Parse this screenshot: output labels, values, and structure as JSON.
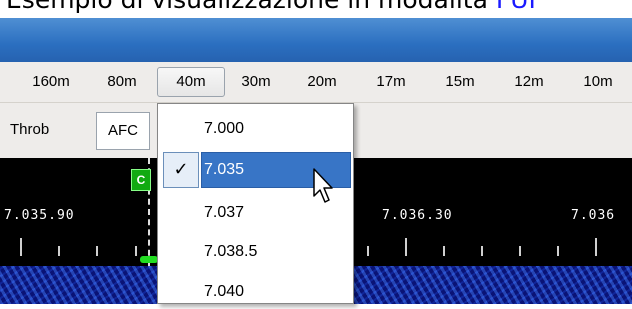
{
  "caption": {
    "text": "Esempio di visualizzazione in modalità ",
    "link": "FUI"
  },
  "bands": [
    "160m",
    "80m",
    "40m",
    "30m",
    "20m",
    "17m",
    "15m",
    "12m",
    "10m"
  ],
  "active_band": "40m",
  "toolbar": {
    "throb": "Throb",
    "afc": "AFC"
  },
  "scope": {
    "cursor_label": "C",
    "freq_labels": [
      "7.035.90",
      "7.036.30",
      "7.036"
    ]
  },
  "menu": {
    "items": [
      "7.000",
      "7.035",
      "7.037",
      "7.038.5",
      "7.040"
    ],
    "selected": "7.035",
    "check_glyph": "✓"
  },
  "colors": {
    "accent": "#3875c6",
    "titlebar": "#2b6fc0",
    "cursor_box": "#11aa11",
    "waterfall": "#0f1e9e"
  },
  "icons": [
    "check-icon",
    "mouse-pointer-icon"
  ]
}
